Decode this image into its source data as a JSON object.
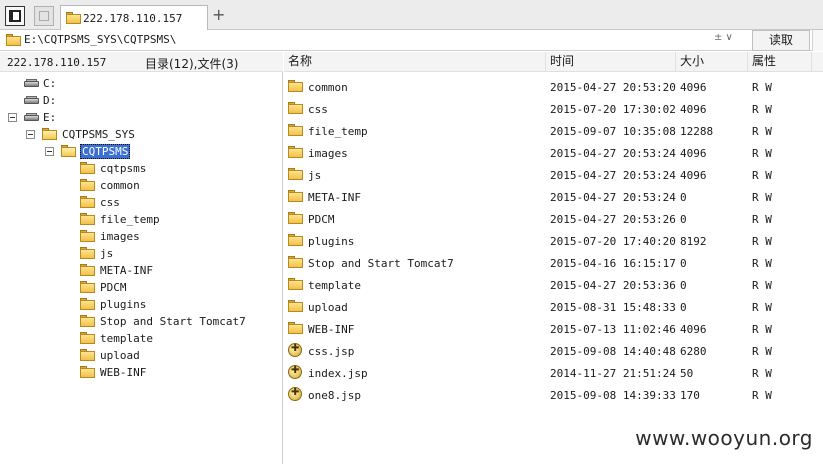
{
  "tabbar": {
    "active_tab_label": "222.178.110.157",
    "add_tab_symbol": "+"
  },
  "address": {
    "path": "E:\\CQTPSMS_SYS\\CQTPSMS\\",
    "dropdown_symbol": "±  ∨",
    "read_button_label": "读取"
  },
  "left_panel": {
    "host": "222.178.110.157",
    "summary": "目录(12),文件(3)",
    "drives": [
      "C:",
      "D:",
      "E:"
    ],
    "parent_folder": "CQTPSMS_SYS",
    "selected_folder": "CQTPSMS",
    "subfolders": [
      "cqtpsms",
      "common",
      "css",
      "file_temp",
      "images",
      "js",
      "META-INF",
      "PDCM",
      "plugins",
      "Stop and Start Tomcat7",
      "template",
      "upload",
      "WEB-INF"
    ]
  },
  "columns": {
    "name": "名称",
    "time": "时间",
    "size": "大小",
    "attr": "属性"
  },
  "files": [
    {
      "name": "common",
      "time": "2015-04-27 20:53:20",
      "size": "4096",
      "attr": "R W",
      "type": "folder"
    },
    {
      "name": "css",
      "time": "2015-07-20 17:30:02",
      "size": "4096",
      "attr": "R W",
      "type": "folder"
    },
    {
      "name": "file_temp",
      "time": "2015-09-07 10:35:08",
      "size": "12288",
      "attr": "R W",
      "type": "folder"
    },
    {
      "name": "images",
      "time": "2015-04-27 20:53:24",
      "size": "4096",
      "attr": "R W",
      "type": "folder"
    },
    {
      "name": "js",
      "time": "2015-04-27 20:53:24",
      "size": "4096",
      "attr": "R W",
      "type": "folder"
    },
    {
      "name": "META-INF",
      "time": "2015-04-27 20:53:24",
      "size": "0",
      "attr": "R W",
      "type": "folder"
    },
    {
      "name": "PDCM",
      "time": "2015-04-27 20:53:26",
      "size": "0",
      "attr": "R W",
      "type": "folder"
    },
    {
      "name": "plugins",
      "time": "2015-07-20 17:40:20",
      "size": "8192",
      "attr": "R W",
      "type": "folder"
    },
    {
      "name": "Stop and Start Tomcat7",
      "time": "2015-04-16 16:15:17",
      "size": "0",
      "attr": "R W",
      "type": "folder"
    },
    {
      "name": "template",
      "time": "2015-04-27 20:53:36",
      "size": "0",
      "attr": "R W",
      "type": "folder"
    },
    {
      "name": "upload",
      "time": "2015-08-31 15:48:33",
      "size": "0",
      "attr": "R W",
      "type": "folder"
    },
    {
      "name": "WEB-INF",
      "time": "2015-07-13 11:02:46",
      "size": "4096",
      "attr": "R W",
      "type": "folder"
    },
    {
      "name": "css.jsp",
      "time": "2015-09-08 14:40:48",
      "size": "6280",
      "attr": "R W",
      "type": "file"
    },
    {
      "name": "index.jsp",
      "time": "2014-11-27 21:51:24",
      "size": "50",
      "attr": "R W",
      "type": "file"
    },
    {
      "name": "one8.jsp",
      "time": "2015-09-08 14:39:33",
      "size": "170",
      "attr": "R W",
      "type": "file"
    }
  ],
  "watermark": "www.wooyun.org"
}
